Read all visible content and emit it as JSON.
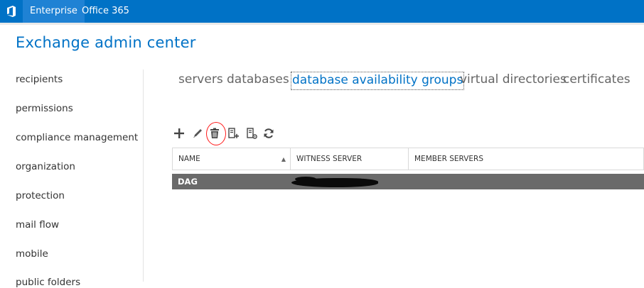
{
  "topbar": {
    "tabs": [
      {
        "label": "Enterprise",
        "active": true
      },
      {
        "label": "Office 365",
        "active": false
      }
    ],
    "accent_color": "#0072c6"
  },
  "app": {
    "title": "Exchange admin center"
  },
  "sidebar": {
    "items": [
      {
        "label": "recipients"
      },
      {
        "label": "permissions"
      },
      {
        "label": "compliance management"
      },
      {
        "label": "organization"
      },
      {
        "label": "protection"
      },
      {
        "label": "mail flow"
      },
      {
        "label": "mobile"
      },
      {
        "label": "public folders"
      }
    ]
  },
  "subtabs": [
    {
      "label": "servers",
      "active": false
    },
    {
      "label": "databases",
      "active": false
    },
    {
      "label": "database availability groups",
      "active": true
    },
    {
      "label": "virtual directories",
      "active": false
    },
    {
      "label": "certificates",
      "active": false
    }
  ],
  "toolbar": {
    "icons": [
      "plus-icon",
      "pencil-icon",
      "trash-icon",
      "add-server-icon",
      "manage-membership-icon",
      "refresh-icon"
    ]
  },
  "table": {
    "columns": [
      "NAME",
      "WITNESS SERVER",
      "MEMBER SERVERS"
    ],
    "rows": [
      {
        "name": "DAG",
        "witness_server": "",
        "member_servers": "",
        "selected": true
      }
    ]
  }
}
